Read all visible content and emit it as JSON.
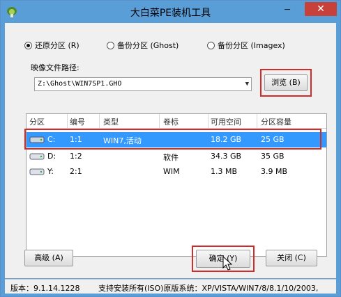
{
  "window": {
    "title": "大白菜PE装机工具",
    "min_glyph": "─",
    "max_glyph": "☐",
    "close_glyph": "✕"
  },
  "mode": {
    "options": [
      {
        "label": "还原分区 (R)",
        "selected": true
      },
      {
        "label": "备份分区 (Ghost)",
        "selected": false
      },
      {
        "label": "备份分区 (Imagex)",
        "selected": false
      }
    ]
  },
  "image_path": {
    "label": "映像文件路径:",
    "value": "Z:\\Ghost\\WIN7SP1.GHO",
    "dropdown_glyph": "▼",
    "browse_label": "浏览 (B)"
  },
  "table": {
    "columns": [
      "分区",
      "编号",
      "类型",
      "卷标",
      "可用空间",
      "分区容量"
    ],
    "rows": [
      {
        "drive": "C:",
        "number": "1:1",
        "type": "WIN7,活动",
        "label": "",
        "free": "18.2 GB",
        "size": "25 GB",
        "selected": true
      },
      {
        "drive": "D:",
        "number": "1:2",
        "type": "",
        "label": "软件",
        "free": "34.3 GB",
        "size": "35 GB",
        "selected": false
      },
      {
        "drive": "Y:",
        "number": "2:1",
        "type": "",
        "label": "WIM",
        "free": "1.3 MB",
        "size": "3.9 MB",
        "selected": false
      }
    ]
  },
  "buttons": {
    "advanced": "高级 (A)",
    "ok": "确定 (Y)",
    "close": "关闭 (C)"
  },
  "statusbar": {
    "version": "版本：9.1.14.1228",
    "support": "支持安装所有(ISO)原版系统：XP/VISTA/WIN7/8/8.1/10/2003,"
  },
  "colors": {
    "titlebar": "#5a9ed8",
    "selection": "#3399ff",
    "highlight": "#d42a2a"
  }
}
